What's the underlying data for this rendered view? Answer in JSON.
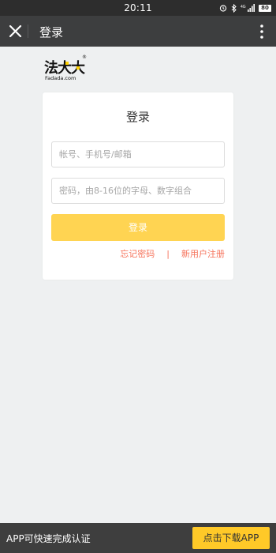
{
  "status_bar": {
    "time": "20:11",
    "battery": "80",
    "icons": [
      "alarm-icon",
      "bluetooth-icon",
      "signal-4g-icon",
      "battery-icon"
    ]
  },
  "title_bar": {
    "title": "登录",
    "close_icon": "close-icon",
    "more_icon": "more-vertical-icon"
  },
  "logo": {
    "brand_mark": "法大大",
    "domain": "Fadada.com",
    "registered": "®"
  },
  "login_card": {
    "title": "登录",
    "account_placeholder": "帐号、手机号/邮箱",
    "account_value": "",
    "password_placeholder": "密码，由8-16位的字母、数字组合",
    "password_value": "",
    "login_button": "登录",
    "forgot_password": "忘记密码",
    "separator": "|",
    "register": "新用户注册"
  },
  "bottom_bar": {
    "promo_text": "APP可快速完成认证",
    "download_button": "点击下载APP"
  },
  "colors": {
    "accent_yellow": "#ffd452",
    "download_yellow": "#ffc928",
    "link_orange": "#f6725a",
    "header_dark": "#3d3e3f",
    "page_bg": "#eef0f1"
  }
}
